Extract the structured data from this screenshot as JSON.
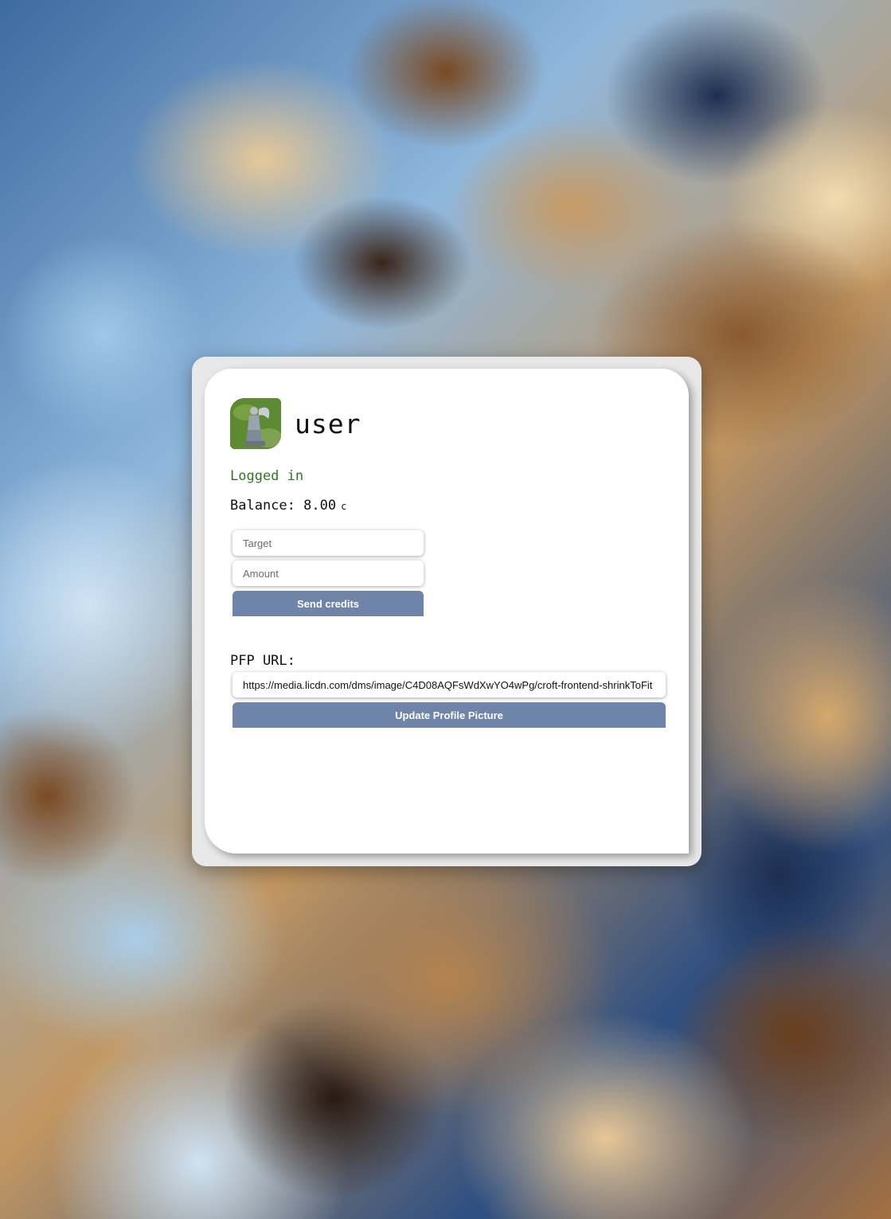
{
  "profile": {
    "username": "user",
    "status": "Logged in",
    "balance_label": "Balance: 8.00",
    "balance_unit": "c"
  },
  "transfer": {
    "target_placeholder": "Target",
    "amount_placeholder": "Amount",
    "send_label": "Send credits"
  },
  "pfp": {
    "label": "PFP URL:",
    "url_value": "https://media.licdn.com/dms/image/C4D08AQFsWdXwYO4wPg/croft-frontend-shrinkToFit",
    "update_label": "Update Profile Picture"
  },
  "colors": {
    "status_green": "#2c7a1e",
    "button_bg": "#6e84a8"
  }
}
